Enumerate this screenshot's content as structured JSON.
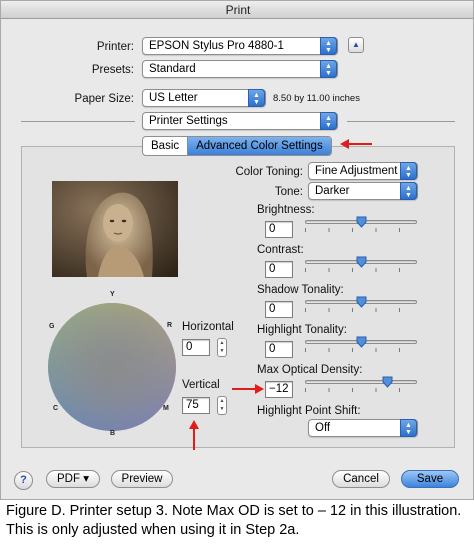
{
  "window": {
    "title": "Print"
  },
  "printer": {
    "label": "Printer:",
    "value": "EPSON Stylus Pro 4880-1"
  },
  "presets": {
    "label": "Presets:",
    "value": "Standard"
  },
  "paper_size": {
    "label": "Paper Size:",
    "value": "US Letter",
    "dimensions": "8.50 by 11.00 inches"
  },
  "section": {
    "value": "Printer Settings"
  },
  "tabs": [
    {
      "label": "Basic",
      "selected": false
    },
    {
      "label": "Advanced Color Settings",
      "selected": true
    }
  ],
  "color_toning": {
    "label": "Color Toning:",
    "value": "Fine Adjustment"
  },
  "tone": {
    "label": "Tone:",
    "value": "Darker"
  },
  "sliders": [
    {
      "label": "Brightness:",
      "value": "0",
      "level": 0.5
    },
    {
      "label": "Contrast:",
      "value": "0",
      "level": 0.5
    },
    {
      "label": "Shadow Tonality:",
      "value": "0",
      "level": 0.5
    },
    {
      "label": "Highlight Tonality:",
      "value": "0",
      "level": 0.5
    },
    {
      "label": "Max Optical Density:",
      "value": "−12",
      "level": 0.73
    }
  ],
  "highlight_point_shift": {
    "label": "Highlight Point Shift:",
    "value": "Off"
  },
  "color_wheel": {
    "y": "Y",
    "r": "R",
    "m": "M",
    "b": "B",
    "c": "C",
    "g": "G"
  },
  "horizontal": {
    "label": "Horizontal",
    "value": "0"
  },
  "vertical": {
    "label": "Vertical",
    "value": "75"
  },
  "bottom": {
    "help": "?",
    "pdf": "PDF ▾",
    "preview": "Preview",
    "cancel": "Cancel",
    "save": "Save"
  },
  "caption": "Figure D. Printer setup 3. Note Max OD is set to – 12 in this illustration. This is only adjusted when using it in Step 2a.",
  "colors": {
    "accent": "#3d7fd8",
    "annotation_arrow": "#e21b1b",
    "photo_tone": "#5a4630"
  }
}
